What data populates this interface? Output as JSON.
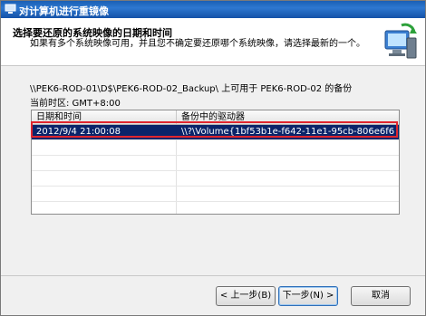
{
  "window": {
    "title": "对计算机进行重镜像"
  },
  "header": {
    "title": "选择要还原的系统映像的日期和时间",
    "description": "如果有多个系统映像可用，并且您不确定要还原哪个系统映像，请选择最新的一个。"
  },
  "main": {
    "backup_path": "\\\\PEK6-ROD-01\\D$\\PEK6-ROD-02_Backup\\ 上可用于 PEK6-ROD-02 的备份",
    "timezone": "当前时区: GMT+8:00",
    "columns": [
      "日期和时间",
      "备份中的驱动器"
    ],
    "rows": [
      {
        "datetime": "2012/9/4 21:00:08",
        "drive": "\\\\?\\Volume{1bf53b1e-f642-11e1-95cb-806e6f6"
      }
    ]
  },
  "buttons": {
    "back": "< 上一步(B)",
    "next": "下一步(N) >",
    "cancel": "取消"
  },
  "colors": {
    "selection": "#0a246a",
    "highlight_border": "#e0262e",
    "titlebar": "#2e78d0"
  }
}
